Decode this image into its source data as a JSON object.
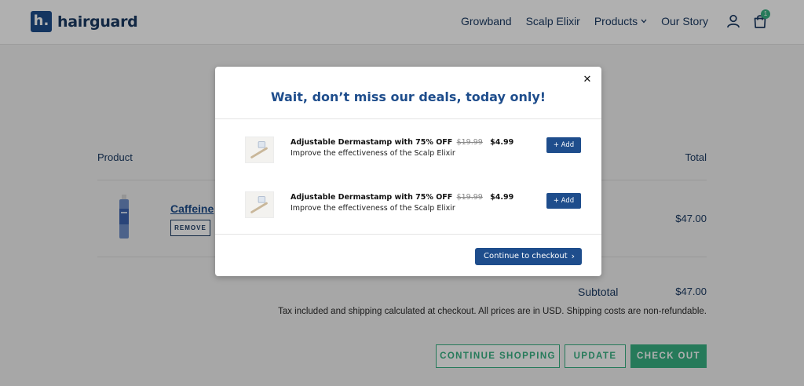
{
  "brand": {
    "logo_mark": "h.",
    "name": "hairguard"
  },
  "nav": {
    "items": [
      "Growband",
      "Scalp Elixir",
      "Products",
      "Our Story"
    ],
    "products_chevron": "⌄",
    "account_icon": "user-icon",
    "cart_icon": "bag-icon",
    "cart_count": "1"
  },
  "cart": {
    "col_product": "Product",
    "col_total": "Total",
    "item": {
      "name": "Caffeine",
      "remove_label": "REMOVE",
      "total": "$47.00"
    },
    "subtotal_label": "Subtotal",
    "subtotal_value": "$47.00",
    "tax_note": "Tax included and shipping calculated at checkout. All prices are in USD. Shipping costs are non-refundable.",
    "buttons": {
      "continue": "CONTINUE SHOPPING",
      "update": "UPDATE",
      "checkout": "CHECK OUT"
    }
  },
  "modal": {
    "close": "✕",
    "title": "Wait, don’t miss our deals, today only!",
    "offers": [
      {
        "title": "Adjustable Dermastamp with 75% OFF",
        "old_price": "$19.99",
        "new_price": "$4.99",
        "desc": "Improve the effectiveness of the Scalp Elixir",
        "add_label": "+ Add"
      },
      {
        "title": "Adjustable Dermastamp with 75% OFF",
        "old_price": "$19.99",
        "new_price": "$4.99",
        "desc": "Improve the effectiveness of the Scalp Elixir",
        "add_label": "+ Add"
      }
    ],
    "checkout_label": "Continue to checkout",
    "checkout_chevron": "›"
  },
  "colors": {
    "brand_blue": "#1e4d8c",
    "accent_green": "#38b183",
    "text_navy": "#1b3a63"
  }
}
